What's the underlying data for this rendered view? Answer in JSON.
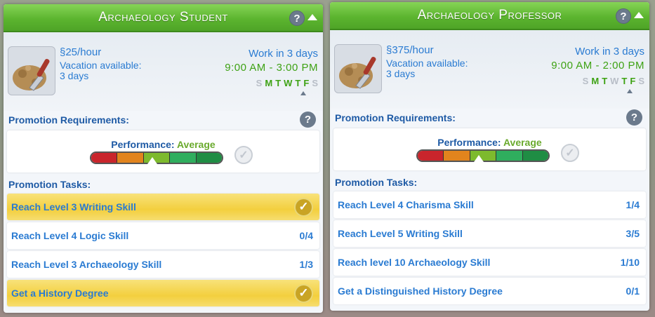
{
  "panels": [
    {
      "title": "Archaeology Student",
      "pay": "25/hour",
      "vacation": "Vacation available:",
      "vacation_days": "3 days",
      "work_in": "Work in 3 days",
      "hours": "9:00  AM - 3:00  PM",
      "days": [
        "S",
        "M",
        "T",
        "W",
        "T",
        "F",
        "S"
      ],
      "active_days": [
        false,
        true,
        true,
        true,
        true,
        true,
        false
      ],
      "promotion_requirements_label": "Promotion Requirements:",
      "performance_label": "Performance:",
      "performance_level": "Average",
      "promotion_tasks_label": "Promotion Tasks:",
      "tasks": [
        {
          "label": "Reach Level 3 Writing Skill",
          "count": "",
          "done": true
        },
        {
          "label": "Reach Level 4 Logic Skill",
          "count": "0/4",
          "done": false
        },
        {
          "label": "Reach Level 3 Archaeology Skill",
          "count": "1/3",
          "done": false
        },
        {
          "label": "Get a History Degree",
          "count": "",
          "done": true
        }
      ]
    },
    {
      "title": "Archaeology Professor",
      "pay": "375/hour",
      "vacation": "Vacation available:",
      "vacation_days": "3 days",
      "work_in": "Work in 3 days",
      "hours": "9:00  AM - 2:00  PM",
      "days": [
        "S",
        "M",
        "T",
        "W",
        "T",
        "F",
        "S"
      ],
      "active_days": [
        false,
        true,
        true,
        false,
        true,
        true,
        false
      ],
      "promotion_requirements_label": "Promotion Requirements:",
      "performance_label": "Performance:",
      "performance_level": "Average",
      "promotion_tasks_label": "Promotion Tasks:",
      "tasks": [
        {
          "label": "Reach Level 4 Charisma Skill",
          "count": "1/4",
          "done": false
        },
        {
          "label": "Reach Level 5 Writing Skill",
          "count": "3/5",
          "done": false
        },
        {
          "label": "Reach level 10 Archaeology Skill",
          "count": "1/10",
          "done": false
        },
        {
          "label": "Get a Distinguished History Degree",
          "count": "0/1",
          "done": false
        }
      ]
    }
  ],
  "colors": {
    "header_green": "#5cb52f",
    "text_blue": "#2a7bd2",
    "label_blue": "#1e5aa5",
    "active_day": "#3ea214",
    "inactive_day": "#b8bec7",
    "task_done_gold": "#f3cf3e",
    "performance_segments": [
      "#c9252c",
      "#e2841d",
      "#7dba2d",
      "#2fae5e",
      "#1f8d44"
    ]
  },
  "performance_fraction": 0.47,
  "icons": {
    "simoleon": "simoleon-icon",
    "help": "help-icon",
    "collapse": "collapse-arrow-icon",
    "check": "check-icon",
    "career": "trowel-dirt-icon"
  }
}
